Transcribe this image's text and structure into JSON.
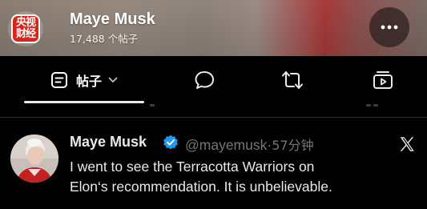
{
  "header": {
    "logo_lines": [
      "央视",
      "财经"
    ],
    "name": "Maye Musk",
    "post_count": "17,488 个帖子",
    "more_icon": "more-horizontal-icon"
  },
  "tabs": [
    {
      "label": "帖子",
      "icon": "posts-icon",
      "selected": true
    },
    {
      "label": "",
      "icon": "reply-bubble-icon",
      "selected": false
    },
    {
      "label": "",
      "icon": "repost-icon",
      "selected": false
    },
    {
      "label": "",
      "icon": "media-icon",
      "selected": false
    }
  ],
  "tweet": {
    "author": "Maye Musk",
    "verified": true,
    "handle": "@mayemusk",
    "separator": "·",
    "time": "57分钟",
    "text_line1": "I went to see the Terracotta Warriors on",
    "text_line2": "Elon‘s recommendation. It is unbelievable.",
    "source_icon": "x-logo-icon"
  },
  "colors": {
    "background": "#000000",
    "text": "#e7e9ea",
    "muted": "#71767b",
    "verified_blue": "#1d9bf0",
    "divider": "#2f3336",
    "logo_red": "#d9261c"
  }
}
